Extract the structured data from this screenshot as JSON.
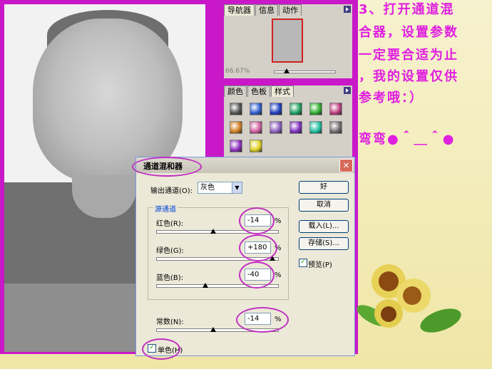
{
  "navigator": {
    "tabs": [
      "导航器",
      "信息",
      "动作"
    ],
    "zoom": "66.67%"
  },
  "styles_panel": {
    "tabs": [
      "颜色",
      "色板",
      "样式"
    ],
    "swatch_colors": [
      "#555555",
      "#3060d0",
      "#2040c0",
      "#20a060",
      "#30b030",
      "#c04080",
      "#d08020",
      "#d060a0",
      "#9060c0",
      "#8030c0",
      "#20c0a0",
      "#707070",
      "#9030c0",
      "#e0d020"
    ]
  },
  "dialog": {
    "title": "通道混和器",
    "output_channel_label": "输出通道(O):",
    "output_channel_value": "灰色",
    "source_group_label": "源通道",
    "red_label": "红色(R):",
    "red_value": "-14",
    "green_label": "绿色(G):",
    "green_value": "+180",
    "blue_label": "蓝色(B):",
    "blue_value": "-40",
    "constant_label": "常数(N):",
    "constant_value": "-14",
    "percent": "%",
    "ok_label": "好",
    "cancel_label": "取消",
    "load_label": "载入(L)...",
    "save_label": "存储(S)...",
    "preview_label": "预览(P)",
    "monochrome_label": "单色(H)",
    "preview_checked": true,
    "monochrome_checked": true
  },
  "annotation": {
    "line1": "3、打开通道混",
    "line2": "合器，设置参数",
    "line3": "一定要合适为止",
    "line4": "，我的设置仅供",
    "line5": "参考哦：）",
    "line6": "弯弯●＾＿＾●"
  }
}
